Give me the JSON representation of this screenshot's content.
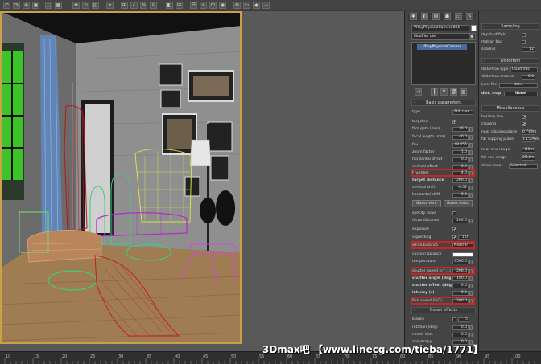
{
  "toolbar": {
    "icons": [
      "undo-icon",
      "redo-icon",
      "link-icon",
      "unlink-icon",
      "bind-icon",
      "filter-icon",
      "select-icon",
      "select-region-icon",
      "window-crossing-icon",
      "move-icon",
      "rotate-icon",
      "scale-icon",
      "reference-icon",
      "pivot-icon",
      "snap-icon",
      "angle-snap-icon",
      "percent-snap-icon",
      "spinner-snap-icon",
      "named-selection-icon",
      "mirror-icon",
      "align-icon",
      "layer-icon",
      "curve-icon",
      "schematic-icon",
      "material-icon",
      "render-setup-icon",
      "render-frame-icon",
      "render-icon",
      "teapot-icon"
    ]
  },
  "command_panel": {
    "tabs": [
      "create-icon",
      "modify-icon",
      "hierarchy-icon",
      "motion-icon",
      "display-icon",
      "utilities-icon"
    ],
    "object_name": "VRayPhysicalCamera001",
    "modifier_list": "Modifier List",
    "stack_item": "VRayPhysicalCamera",
    "basic_params": {
      "title": "Basic parameters",
      "type_label": "type",
      "type_value": "Still cam",
      "targeted": "targeted",
      "film_gate": "film gate (mm)",
      "film_gate_value": "36.0",
      "focal_length": "focal length (mm)",
      "focal_length_value": "40.0",
      "fov": "fov",
      "fov_value": "48.455",
      "zoom_factor": "zoom factor",
      "zoom_factor_value": "1.0",
      "horizontal_offset": "horizontal offset",
      "horizontal_offset_value": "0.0",
      "vertical_offset": "vertical offset",
      "vertical_offset_value": "0.0",
      "fnumber": "f-number",
      "fnumber_value": "4.0",
      "target_distance": "target distance",
      "target_distance_value": "200.0",
      "vertical_shift": "vertical shift",
      "vertical_shift_value": "-0.02",
      "horizontal_shift": "horizontal shift",
      "horizontal_shift_value": "0.0",
      "guess_vert": "Guess vert.",
      "guess_horiz": "Guess horiz.",
      "specify_focus": "specify focus",
      "focus_distance": "focus distance",
      "focus_distance_value": "200.0",
      "exposure": "exposure",
      "vignetting": "vignetting",
      "vignetting_value": "1.0",
      "white_balance": "white balance",
      "white_balance_value": "Neutral",
      "custom_balance": "custom balance",
      "temperature": "temperature",
      "temperature_value": "6500.0",
      "shutter_speed": "shutter speed (s^-1)",
      "shutter_speed_value": "200.0",
      "shutter_angle": "shutter angle (deg)",
      "shutter_angle_value": "180.0",
      "shutter_offset": "shutter offset (deg)",
      "shutter_offset_value": "0.0",
      "latency": "latency (s)",
      "latency_value": "0.0",
      "film_speed": "film speed (ISO)",
      "film_speed_value": "200.0"
    },
    "bokeh": {
      "title": "Bokeh effects",
      "blades": "blades",
      "blades_value": "5",
      "rotation": "rotation (deg)",
      "rotation_value": "0.0",
      "center_bias": "center bias",
      "center_bias_value": "0.0",
      "anisotropy": "anisotropy",
      "anisotropy_value": "0.0"
    }
  },
  "side_panel": {
    "sampling": {
      "title": "Sampling",
      "dof": "depth-of-field",
      "motion_blur": "motion blur",
      "subdivs": "subdivs",
      "subdivs_value": "12"
    },
    "distortion": {
      "title": "Distortion",
      "type_label": "distortion type",
      "type_value": "Quadratic",
      "amount": "distortion amount",
      "amount_value": "0.0",
      "lens_file": "Lens file",
      "lens_file_value": "None",
      "dist_map": "dist. map",
      "dist_map_value": "None"
    },
    "misc": {
      "title": "Miscellaneous",
      "horizon_line": "horizon line",
      "clipping": "clipping",
      "near_clip": "near clipping plane",
      "near_clip_value": "0.743m",
      "far_clip": "far clipping plane",
      "far_clip_value": "11.509m",
      "near_env": "near env range",
      "near_env_value": "0.0m",
      "far_env": "far env range",
      "far_env_value": "25.4m",
      "show_cone": "show cone",
      "show_cone_value": "Selected"
    }
  },
  "timeline": {
    "ticks": [
      "10",
      "15",
      "20",
      "25",
      "30",
      "35",
      "40",
      "45",
      "50",
      "55",
      "60",
      "65",
      "70",
      "75",
      "80",
      "85",
      "90",
      "95",
      "100"
    ]
  },
  "watermark": "3Dmax吧 【www.linecg.com/tieba/1771】",
  "colors": {
    "highlight": "#d42020",
    "viewport_frame": "#c9a14a"
  }
}
